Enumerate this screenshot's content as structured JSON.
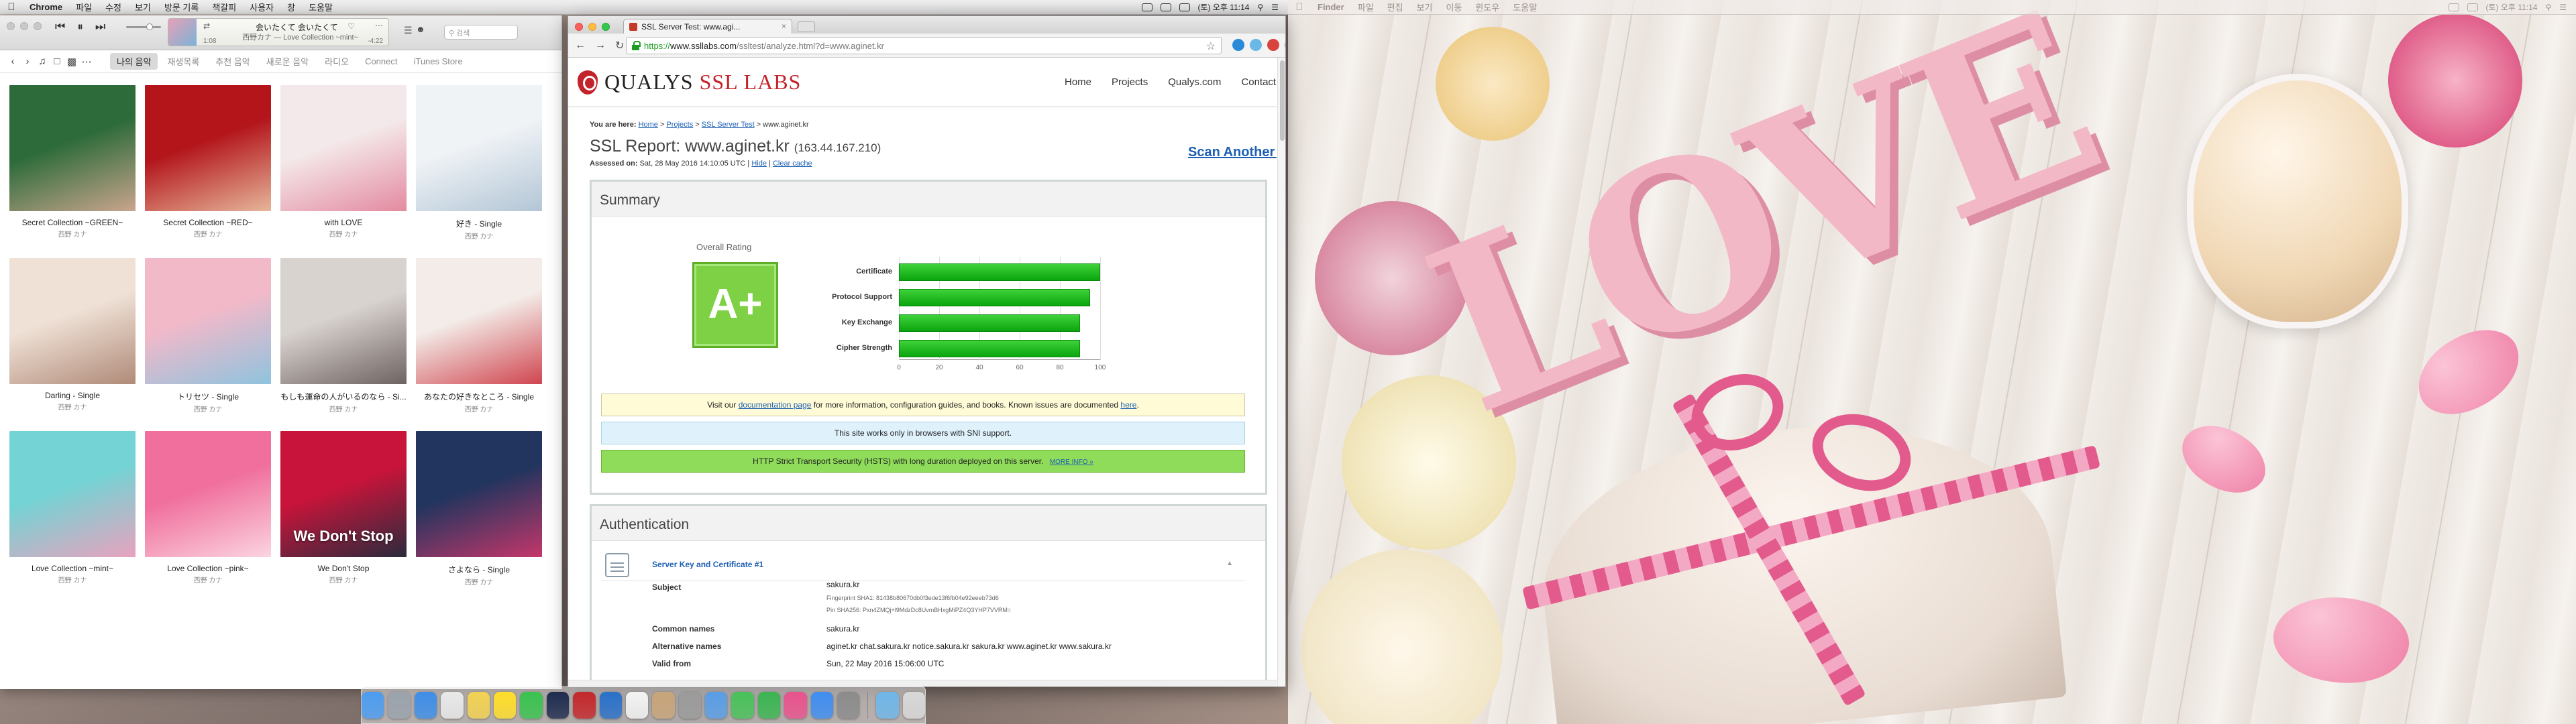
{
  "menubar_left": {
    "app": "Chrome",
    "items": [
      "파일",
      "수정",
      "보기",
      "방문 기록",
      "책갈피",
      "사용자",
      "창",
      "도움말"
    ],
    "clock": "(토) 오후 11:14"
  },
  "menubar_right": {
    "app": "Finder",
    "items": [
      "파일",
      "편집",
      "보기",
      "이동",
      "윈도우",
      "도움말"
    ],
    "clock": "(토) 오후 11:14"
  },
  "itunes": {
    "now_playing_title": "会いたくて 会いたくて",
    "now_playing_sub": "西野カナ — Love Collection ~mint~",
    "time_elapsed": "1:08",
    "time_remaining": "-4:22",
    "search_placeholder": "검색",
    "nav_tabs": [
      {
        "label": "나의 음악",
        "active": true
      },
      {
        "label": "재생목록",
        "active": false
      },
      {
        "label": "추천 음악",
        "active": false
      },
      {
        "label": "새로운 음악",
        "active": false
      },
      {
        "label": "라디오",
        "active": false
      },
      {
        "label": "Connect",
        "active": false
      },
      {
        "label": "iTunes Store",
        "active": false
      }
    ],
    "albums": [
      {
        "name": "Secret Collection ~GREEN~",
        "artist": "西野 カナ",
        "c1": "#2d6b3a",
        "c2": "#c9a58d",
        "text": ""
      },
      {
        "name": "Secret Collection ~RED~",
        "artist": "西野 カナ",
        "c1": "#b3151b",
        "c2": "#e6b69a",
        "text": ""
      },
      {
        "name": "with LOVE",
        "artist": "西野 カナ",
        "c1": "#f4e9ea",
        "c2": "#e38aa0",
        "text": ""
      },
      {
        "name": "好き - Single",
        "artist": "西野 カナ",
        "c1": "#f0f3f6",
        "c2": "#b3c6d6",
        "text": ""
      },
      {
        "name": "Darling - Single",
        "artist": "西野 カナ",
        "c1": "#efe1d6",
        "c2": "#b08a78",
        "text": ""
      },
      {
        "name": "トリセツ - Single",
        "artist": "西野 カナ",
        "c1": "#f2b9c9",
        "c2": "#8fc3de",
        "text": ""
      },
      {
        "name": "もしも運命の人がいるのなら - Si...",
        "artist": "西野 カナ",
        "c1": "#d9d3cf",
        "c2": "#6e6360",
        "text": ""
      },
      {
        "name": "あなたの好きなところ - Single",
        "artist": "西野 カナ",
        "c1": "#f3ece8",
        "c2": "#d0454f",
        "text": ""
      },
      {
        "name": "Love Collection ~mint~",
        "artist": "西野 カナ",
        "c1": "#74d3d4",
        "c2": "#e8a2be",
        "text": ""
      },
      {
        "name": "Love Collection ~pink~",
        "artist": "西野 カナ",
        "c1": "#f06f9c",
        "c2": "#fbd4e1",
        "text": ""
      },
      {
        "name": "We Don't Stop",
        "artist": "西野 カナ",
        "c1": "#c8143a",
        "c2": "#2b2b3d",
        "text": "We Don't Stop"
      },
      {
        "name": "さよなら - Single",
        "artist": "西野 カナ",
        "c1": "#22355e",
        "c2": "#c4366a",
        "text": ""
      }
    ]
  },
  "chrome": {
    "tab_title": "SSL Server Test: www.agi...",
    "url_scheme": "https://",
    "url_host": "www.ssllabs.com",
    "url_path": "/ssltest/analyze.html?d=www.aginet.kr",
    "ext_colors": [
      "#2a8ad8",
      "#6bb7e6",
      "#d9433d",
      "#7a8fa5"
    ]
  },
  "ssllabs": {
    "logo_qualys": "QUALYS",
    "logo_ssl": "SSL LABS",
    "nav": [
      "Home",
      "Projects",
      "Qualys.com",
      "Contact"
    ],
    "crumb_prefix": "You are here:",
    "crumb_home": "Home",
    "crumb_projects": "Projects",
    "crumb_test": "SSL Server Test",
    "crumb_current": "www.aginet.kr",
    "title": "SSL Report: www.aginet.kr",
    "ip": "(163.44.167.210)",
    "assessed_label": "Assessed on:",
    "assessed_value": "Sat, 28 May 2016 14:10:05 UTC",
    "hide": "Hide",
    "clear_cache": "Clear cache",
    "scan_another": "Scan Another »",
    "summary_title": "Summary",
    "overall_rating": "Overall Rating",
    "grade": "A+",
    "notice_doc_pre": "Visit our",
    "notice_doc_link": "documentation page",
    "notice_doc_post": "for more information, configuration guides, and books. Known issues are documented",
    "notice_doc_here": "here",
    "notice_sni": "This site works only in browsers with SNI support.",
    "notice_hsts": "HTTP Strict Transport Security (HSTS) with long duration deployed on this server.",
    "notice_more": "MORE INFO »",
    "auth_title": "Authentication",
    "cert_title": "Server Key and Certificate #1",
    "cert_rows": [
      {
        "k": "Subject",
        "v": "sakura.kr",
        "s1": "Fingerprint SHA1: 81438b80670db0f3ede13f6fb04e92eeeb73d6",
        "s2": "Pin SHA256: Pxn4ZMQj+l9MdzDc8UvmBHxgMiPZ4Q3YHP7VVRM="
      },
      {
        "k": "Common names",
        "v": "sakura.kr",
        "s1": "",
        "s2": ""
      },
      {
        "k": "Alternative names",
        "v": "aginet.kr chat.sakura.kr notice.sakura.kr sakura.kr www.aginet.kr www.sakura.kr",
        "s1": "",
        "s2": ""
      },
      {
        "k": "Valid from",
        "v": "Sun, 22 May 2016 15:06:00 UTC",
        "s1": "",
        "s2": ""
      }
    ]
  },
  "chart_data": {
    "type": "bar",
    "orientation": "horizontal",
    "categories": [
      "Certificate",
      "Protocol Support",
      "Key Exchange",
      "Cipher Strength"
    ],
    "values": [
      100,
      95,
      90,
      90
    ],
    "xlim": [
      0,
      100
    ],
    "xticks": [
      0,
      20,
      40,
      60,
      80,
      100
    ],
    "bar_color": "#1ec21a"
  },
  "dock": {
    "icons": [
      "finder-icon",
      "launchpad-icon",
      "safari-icon",
      "chrome-icon",
      "notes-icon",
      "talk-icon",
      "line-icon",
      "photoshop-icon",
      "filezilla-icon",
      "app-icon",
      "calendar-icon",
      "contacts-icon",
      "script-icon",
      "mail-icon",
      "messages-icon",
      "facetime-icon",
      "itunes-icon",
      "appstore-icon",
      "preferences-icon",
      "downloads-icon",
      "trash-icon"
    ],
    "colors": [
      "#4c9df0",
      "#9aa3ad",
      "#3e8ee8",
      "#e9e9e9",
      "#f3d253",
      "#ffde2a",
      "#3ac34f",
      "#1f2c4f",
      "#c4282b",
      "#2a71c9",
      "#f4f4f4",
      "#c8a57a",
      "#9b9b9b",
      "#5a9ee6",
      "#49c25a",
      "#3cb552",
      "#e9538e",
      "#3f8ef1",
      "#8c8c8c",
      "#6fb7e9",
      "#d8d8d8"
    ]
  }
}
